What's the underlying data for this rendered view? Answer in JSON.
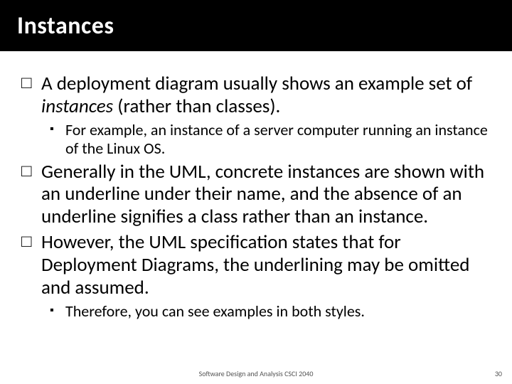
{
  "title": "Instances",
  "bullets": {
    "a": {
      "pre": "A deployment diagram usually shows an example set of ",
      "em": "instances",
      "post": " (rather than classes)."
    },
    "a1": "For example, an instance of a server computer running an instance of the Linux OS.",
    "b": "Generally in the UML, concrete instances are shown with an underline under their name, and the absence of an underline signifies a class rather than an instance.",
    "c": "However, the UML specification states that for Deployment Diagrams, the underlining may be omitted and assumed.",
    "c1": "Therefore, you can see examples in both styles."
  },
  "footer": "Software Design and Analysis CSCI 2040",
  "page": "30",
  "glyphs": {
    "box": "□",
    "square": "▪"
  }
}
